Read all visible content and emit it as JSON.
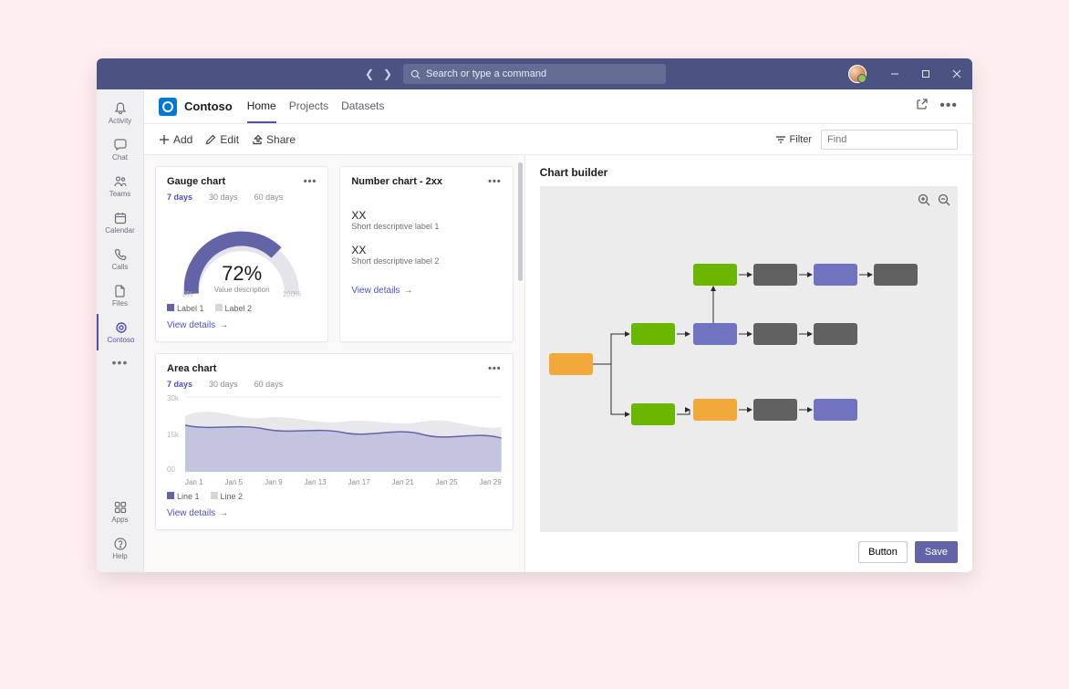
{
  "titlebar": {
    "search_placeholder": "Search or type a command"
  },
  "rail": {
    "items": [
      {
        "label": "Activity"
      },
      {
        "label": "Chat"
      },
      {
        "label": "Teams"
      },
      {
        "label": "Calendar"
      },
      {
        "label": "Calls"
      },
      {
        "label": "Files"
      },
      {
        "label": "Contoso"
      }
    ],
    "bottom": [
      {
        "label": "Apps"
      },
      {
        "label": "Help"
      }
    ]
  },
  "header": {
    "app_name": "Contoso",
    "tabs": [
      "Home",
      "Projects",
      "Datasets"
    ]
  },
  "toolbar": {
    "add": "Add",
    "edit": "Edit",
    "share": "Share",
    "filter": "Filter",
    "find_placeholder": "Find"
  },
  "cards": {
    "gauge": {
      "title": "Gauge chart",
      "ranges": [
        "7 days",
        "30 days",
        "60 days"
      ],
      "value": "72%",
      "desc": "Value description",
      "min": "0%",
      "max": "100%",
      "legend": [
        "Label 1",
        "Label 2"
      ],
      "link": "View details"
    },
    "number": {
      "title": "Number chart - 2xx",
      "items": [
        {
          "n": "XX",
          "d": "Short descriptive label 1"
        },
        {
          "n": "XX",
          "d": "Short descriptive label 2"
        }
      ],
      "link": "View details"
    },
    "area": {
      "title": "Area chart",
      "ranges": [
        "7 days",
        "30 days",
        "60 days"
      ],
      "yticks": [
        "30k",
        "15k",
        "00"
      ],
      "xticks": [
        "Jan 1",
        "Jan 5",
        "Jan 9",
        "Jan 13",
        "Jan 17",
        "Jan 21",
        "Jan 25",
        "Jan 29"
      ],
      "legend": [
        "Line 1",
        "Line 2"
      ],
      "link": "View details"
    }
  },
  "builder": {
    "title": "Chart builder",
    "button": "Button",
    "save": "Save"
  },
  "chart_data": [
    {
      "type": "gauge",
      "title": "Gauge chart",
      "value": 72,
      "min": 0,
      "max": 100,
      "unit": "%",
      "desc": "Value description",
      "series": [
        {
          "name": "Label 1",
          "color": "#6264a7"
        },
        {
          "name": "Label 2",
          "color": "#d6d6dc"
        }
      ]
    },
    {
      "type": "table",
      "title": "Number chart - 2xx",
      "rows": [
        {
          "value": "XX",
          "label": "Short descriptive label 1"
        },
        {
          "value": "XX",
          "label": "Short descriptive label 2"
        }
      ]
    },
    {
      "type": "area",
      "title": "Area chart",
      "xlabel": "",
      "ylabel": "",
      "ylim": [
        0,
        30000
      ],
      "x": [
        "Jan 1",
        "Jan 5",
        "Jan 9",
        "Jan 13",
        "Jan 17",
        "Jan 21",
        "Jan 25",
        "Jan 29"
      ],
      "series": [
        {
          "name": "Line 1",
          "color": "#6264a7",
          "values": [
            19000,
            17500,
            18500,
            16000,
            18000,
            16000,
            19000,
            15500
          ]
        },
        {
          "name": "Line 2",
          "color": "#d6d6dc",
          "values": [
            22000,
            24000,
            21000,
            19500,
            20500,
            19000,
            20000,
            17500
          ]
        }
      ]
    }
  ]
}
